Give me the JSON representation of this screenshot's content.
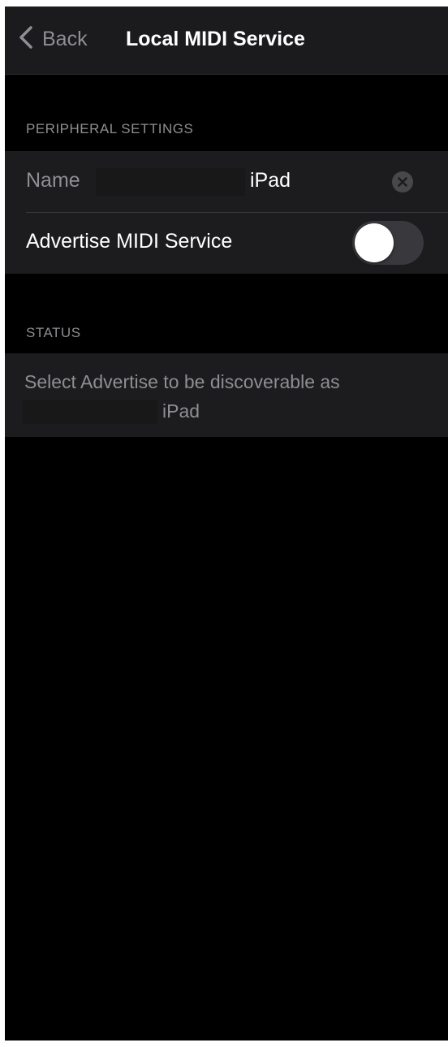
{
  "navbar": {
    "back_label": "Back",
    "title": "Local MIDI Service"
  },
  "peripheral_settings": {
    "header": "PERIPHERAL SETTINGS",
    "name_label": "Name",
    "name_value": "iPad",
    "advertise_label": "Advertise MIDI Service",
    "advertise_enabled": false
  },
  "status": {
    "header": "STATUS",
    "message_line1": "Select Advertise to be discoverable as",
    "message_device": "iPad"
  },
  "icons": {
    "back": "chevron-left-icon",
    "clear": "clear-circle-icon"
  },
  "colors": {
    "background": "#000000",
    "cell": "#1c1c1e",
    "secondary_text": "#8e8e93",
    "toggle_off": "#39393d"
  }
}
